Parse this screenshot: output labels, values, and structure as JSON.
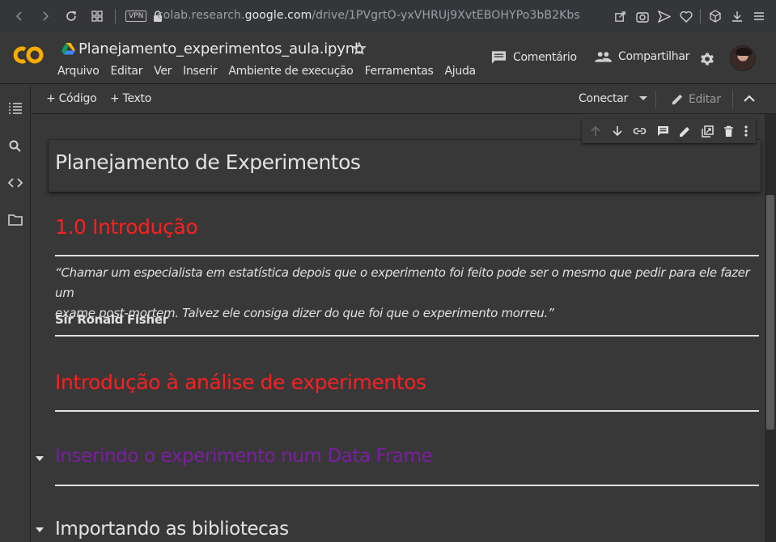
{
  "browser": {
    "vpn_label": "VPN",
    "url_prefix": "colab.research.",
    "url_domain": "google.com",
    "url_path": "/drive/1PVgrtO-yxVHRUj9XvtEBOHYPo3bB2Kbs"
  },
  "header": {
    "notebook_name": "Planejamento_experimentos_aula.ipynb",
    "menu": [
      "Arquivo",
      "Editar",
      "Ver",
      "Inserir",
      "Ambiente de execução",
      "Ferramentas",
      "Ajuda"
    ],
    "comment_label": "Comentário",
    "share_label": "Compartilhar"
  },
  "toolbar": {
    "add_code": "+ Código",
    "add_text": "+ Texto",
    "connect": "Conectar",
    "edit": "Editar"
  },
  "notebook": {
    "active_cell_title": "Planejamento de Experimentos",
    "intro_heading": "1.0 Introdução",
    "quote_line1": "“Chamar um especialista em estatística depois que o experimento foi feito pode ser o mesmo que pedir para ele fazer um",
    "quote_line2": "exame post-mortem. Talvez ele consiga dizer do que foi que o experimento morreu.”",
    "quote_author": "Sir Ronald Fisher",
    "analysis_heading": "Introdução à análise de experimentos",
    "section_dataframe": "Inserindo o experimento num Data Frame",
    "section_libraries": "Importando as bibliotecas"
  },
  "colors": {
    "heading_red": "#ff1f1f",
    "section_purple": "#7a1fa0",
    "logo_orange": "#f9ab00"
  }
}
